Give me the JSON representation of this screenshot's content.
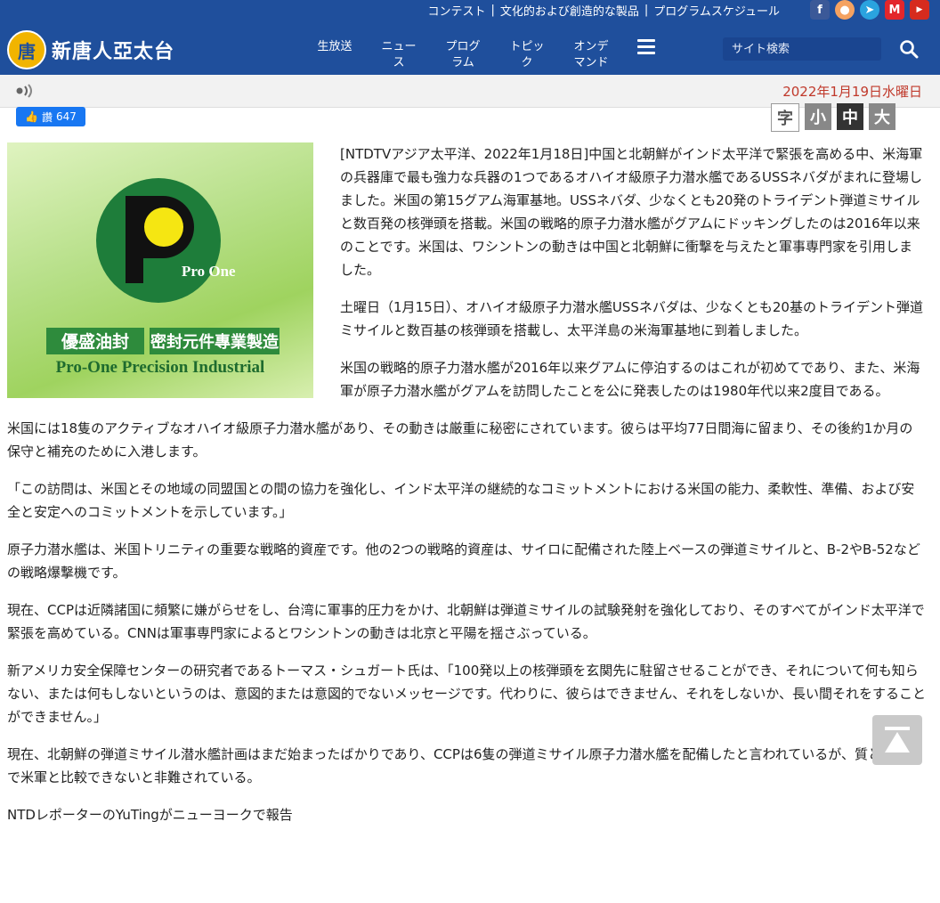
{
  "header": {
    "top_links": [
      "コンテスト",
      "文化的および創造的な製品",
      "プログラムスケジュール"
    ],
    "site_name": "新唐人亞太台",
    "logo_glyph": "唐",
    "nav": [
      {
        "line1": "生放送",
        "line2": ""
      },
      {
        "line1": "ニュー",
        "line2": "ス"
      },
      {
        "line1": "プログ",
        "line2": "ラム"
      },
      {
        "line1": "トピッ",
        "line2": "ク"
      },
      {
        "line1": "オンデ",
        "line2": "マンド"
      }
    ],
    "search_placeholder": "サイト検索",
    "social_icons": [
      "facebook-icon",
      "weibo-icon",
      "telegram-icon",
      "mewe-icon",
      "youtube-icon"
    ],
    "colors": {
      "header_bg": "#1f4f9c",
      "date": "#c0392b"
    }
  },
  "datebar": {
    "date": "2022年1月19日水曜日"
  },
  "like": {
    "label": "讚",
    "count": "647"
  },
  "font_sizes": [
    "字",
    "小",
    "中",
    "大"
  ],
  "ad": {
    "brand": "Pro One",
    "chinese": "優盛油封",
    "chinese2": "密封元件專業製造",
    "english": "Pro-One Precision Industrial"
  },
  "article": {
    "paragraphs": [
      "[NTDTVアジア太平洋、2022年1月18日]中国と北朝鮮がインド太平洋で緊張を高める中、米海軍の兵器庫で最も強力な兵器の1つであるオハイオ級原子力潜水艦であるUSSネバダがまれに登場しました。米国の第15グアム海軍基地。USSネバダ、少なくとも20発のトライデント弾道ミサイルと数百発の核弾頭を搭載。米国の戦略的原子力潜水艦がグアムにドッキングしたのは2016年以来のことです。米国は、ワシントンの動きは中国と北朝鮮に衝撃を与えたと軍事専門家を引用しました。",
      "土曜日（1月15日）、オハイオ級原子力潜水艦USSネバダは、少なくとも20基のトライデント弾道ミサイルと数百基の核弾頭を搭載し、太平洋島の米海軍基地に到着しました。",
      "米国の戦略的原子力潜水艦が2016年以来グアムに停泊するのはこれが初めてであり、また、米海軍が原子力潜水艦がグアムを訪問したことを公に発表したのは1980年代以来2度目である。",
      "米国には18隻のアクティブなオハイオ級原子力潜水艦があり、その動きは厳重に秘密にされています。彼らは平均77日間海に留まり、その後約1か月の保守と補充のために入港します。",
      "「この訪問は、米国とその地域の同盟国との間の協力を強化し、インド太平洋の継続的なコミットメントにおける米国の能力、柔軟性、準備、および安全と安定へのコミットメントを示しています。」",
      "原子力潜水艦は、米国トリニティの重要な戦略的資産です。他の2つの戦略的資産は、サイロに配備された陸上ベースの弾道ミサイルと、B-2やB-52などの戦略爆撃機です。",
      "現在、CCPは近隣諸国に頻繁に嫌がらせをし、台湾に軍事的圧力をかけ、北朝鮮は弾道ミサイルの試験発射を強化しており、そのすべてがインド太平洋で緊張を高めている。CNNは軍事専門家によるとワシントンの動きは北京と平陽を揺さぶっている。",
      "新アメリカ安全保障センターの研究者であるトーマス・シュガート氏は、「100発以上の核弾頭を玄関先に駐留させることができ、それについて何も知らない、または何もしないというのは、意図的または意図的でないメッセージです。代わりに、彼らはできません、それをしないか、長い間それをすることができません。」",
      "現在、北朝鮮の弾道ミサイル潜水艦計画はまだ始まったばかりであり、CCPは6隻の弾道ミサイル原子力潜水艦を配備したと言われているが、質と量の点で米軍と比較できないと非難されている。",
      "NTDレポーターのYuTingがニューヨークで報告"
    ]
  }
}
